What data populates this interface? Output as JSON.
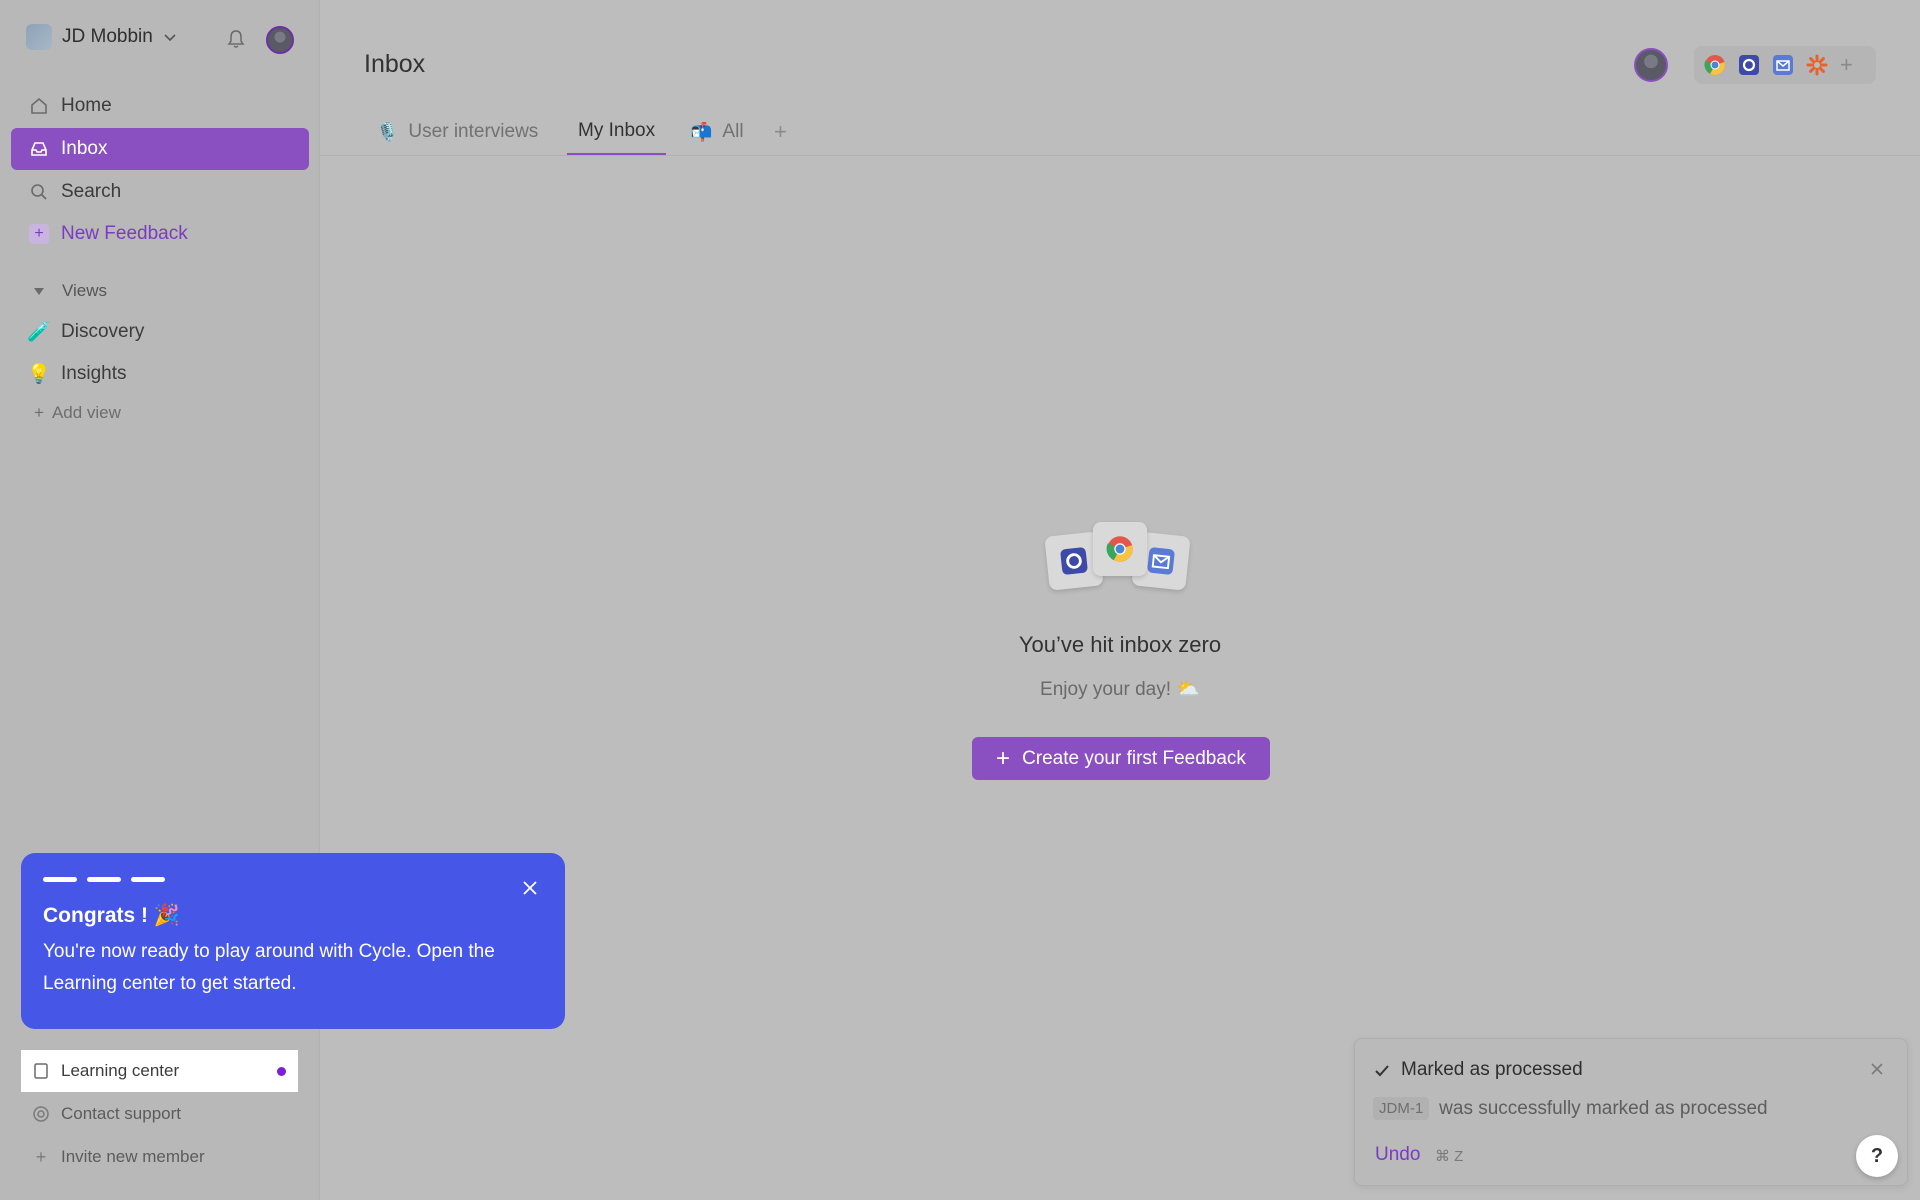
{
  "workspace": {
    "name": "JD Mobbin"
  },
  "sidebar": {
    "nav": [
      {
        "label": "Home"
      },
      {
        "label": "Inbox"
      },
      {
        "label": "Search"
      },
      {
        "label": "New Feedback"
      }
    ],
    "views_label": "Views",
    "views": [
      {
        "emoji": "🧪",
        "label": "Discovery"
      },
      {
        "emoji": "💡",
        "label": "Insights"
      }
    ],
    "add_view": "Add view",
    "bottom": [
      {
        "label": "Learning center"
      },
      {
        "label": "Contact support"
      },
      {
        "label": "Invite new member"
      }
    ]
  },
  "onboarding": {
    "title": "Congrats ! 🎉",
    "body": "You're now ready to play around with Cycle. Open the Learning center to get started."
  },
  "header": {
    "title": "Inbox",
    "tabs": [
      {
        "emoji": "🎙️",
        "label": "User interviews"
      },
      {
        "emoji": "",
        "label": "My Inbox"
      },
      {
        "emoji": "📬",
        "label": "All"
      }
    ],
    "add_tab": "+"
  },
  "empty_state": {
    "title": "You’ve hit inbox zero",
    "subtitle": "Enjoy your day! ⛅",
    "button": "Create your first Feedback",
    "button_plus": "+"
  },
  "toast": {
    "title": "Marked as processed",
    "code": "JDM-1",
    "message": "was successfully marked as processed",
    "undo": "Undo",
    "shortcut": "⌘ Z"
  },
  "help_label": "?",
  "colors": {
    "accent": "#8a4fc1",
    "onboarding_bg": "#4656e6",
    "background": "#bdbdbd"
  }
}
